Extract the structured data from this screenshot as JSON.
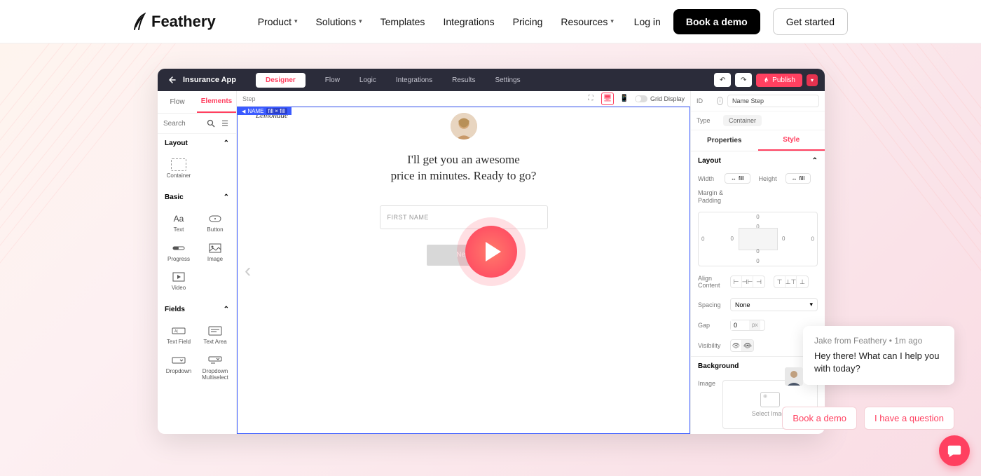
{
  "brand": "Feathery",
  "nav": {
    "product": "Product",
    "solutions": "Solutions",
    "templates": "Templates",
    "integrations": "Integrations",
    "pricing": "Pricing",
    "resources": "Resources"
  },
  "header": {
    "login": "Log in",
    "demo": "Book a demo",
    "start": "Get started"
  },
  "app": {
    "title": "Insurance App",
    "tabs": {
      "designer": "Designer",
      "flow": "Flow",
      "logic": "Logic",
      "integrations": "Integrations",
      "results": "Results",
      "settings": "Settings"
    },
    "publish": "Publish",
    "breadcrumb": "Step",
    "gridDisplay": "Grid Display",
    "selectorName": "NAME",
    "selectorSize": "fill × fill"
  },
  "leftPanel": {
    "tabs": {
      "flow": "Flow",
      "elements": "Elements"
    },
    "searchPlaceholder": "Search",
    "sections": {
      "layout": {
        "title": "Layout",
        "container": "Container"
      },
      "basic": {
        "title": "Basic",
        "text": "Text",
        "button": "Button",
        "progress": "Progress",
        "image": "Image",
        "video": "Video"
      },
      "fields": {
        "title": "Fields",
        "textField": "Text Field",
        "textArea": "Text Area",
        "dropdown": "Dropdown",
        "dropdownMulti": "Dropdown Multiselect"
      }
    }
  },
  "canvas": {
    "brand": "Lemonade",
    "headingLine1": "I'll get you an awesome",
    "headingLine2": "price in minutes. Ready to go?",
    "firstNamePlaceholder": "FIRST NAME",
    "nextLabel": "Next"
  },
  "rightPanel": {
    "idLabel": "ID",
    "idValue": "Name Step",
    "typeLabel": "Type",
    "typeValue": "Container",
    "tabs": {
      "properties": "Properties",
      "style": "Style"
    },
    "layoutTitle": "Layout",
    "widthLabel": "Width",
    "widthValue": "fill",
    "heightLabel": "Height",
    "heightValue": "fill",
    "marginPadding": "Margin & Padding",
    "bmValues": {
      "mt": "0",
      "mr": "0",
      "mb": "0",
      "ml": "0",
      "pt": "0",
      "pr": "0",
      "pb": "0",
      "pl": "0"
    },
    "alignContent": "Align Content",
    "spacingLabel": "Spacing",
    "spacingValue": "None",
    "gapLabel": "Gap",
    "gapValue": "0",
    "gapUnit": "px",
    "visibilityLabel": "Visibility",
    "backgroundTitle": "Background",
    "imageLabel": "Image",
    "selectImage": "Select Image"
  },
  "chat": {
    "from": "Jake from Feathery • 1m ago",
    "message": "Hey there! What can I help you with today?",
    "qr1": "Book a demo",
    "qr2": "I have a question"
  }
}
